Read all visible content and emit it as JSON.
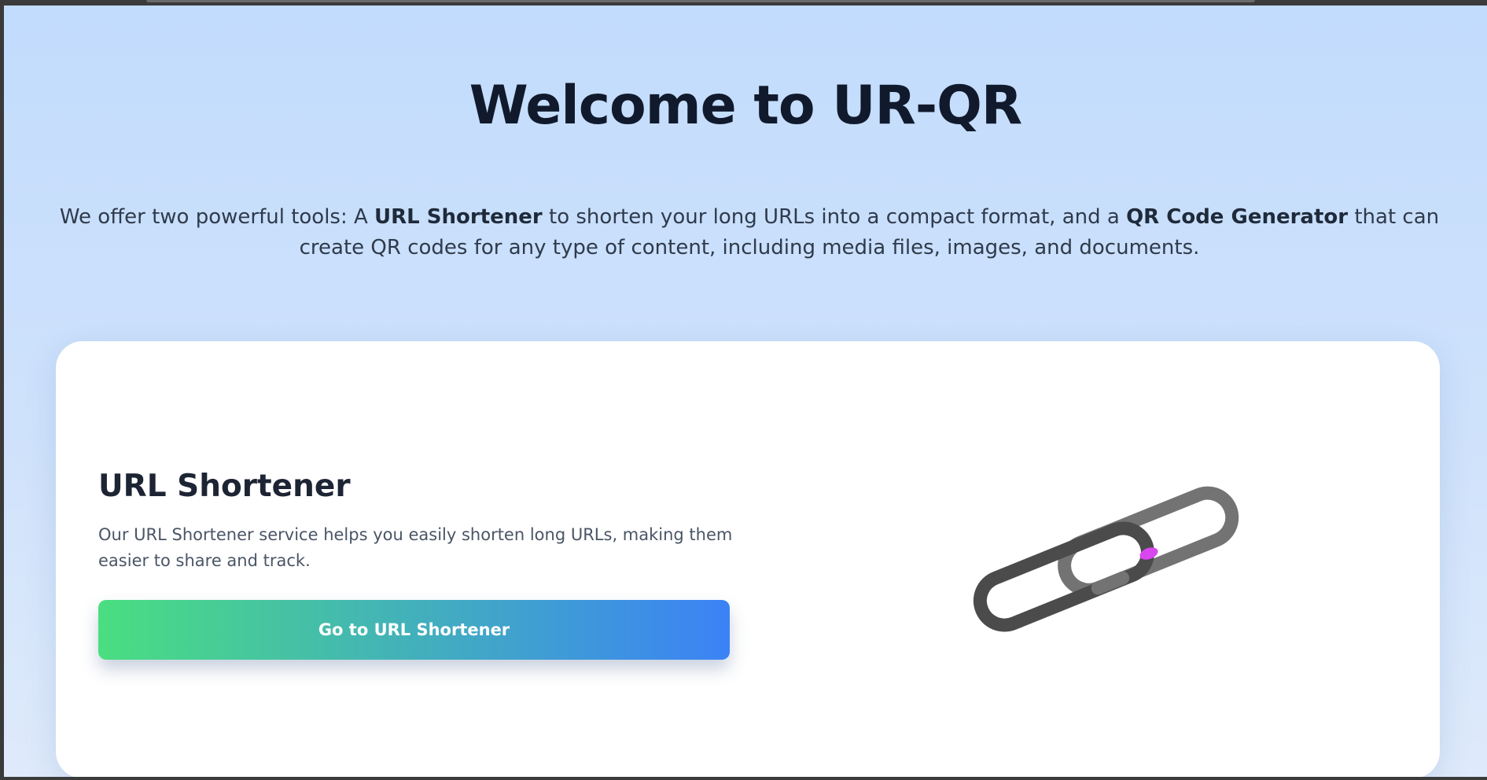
{
  "hero": {
    "title": "Welcome to UR-QR",
    "desc_part1": "We offer two powerful tools: A ",
    "desc_bold1": "URL Shortener",
    "desc_part2": " to shorten your long URLs into a compact format, and a ",
    "desc_bold2": "QR Code Generator",
    "desc_part3": " that can create QR codes for any type of content, including media files, images, and documents."
  },
  "card": {
    "title": "URL Shortener",
    "description": "Our URL Shortener service helps you easily shorten long URLs, making them easier to share and track.",
    "button_label": "Go to URL Shortener",
    "image_icon": "chain-link-icon"
  },
  "colors": {
    "background": "#c2dcfd",
    "title": "#111a2c",
    "button_gradient_start": "#4ade80",
    "button_gradient_end": "#3b82f6",
    "card": "#ffffff"
  }
}
